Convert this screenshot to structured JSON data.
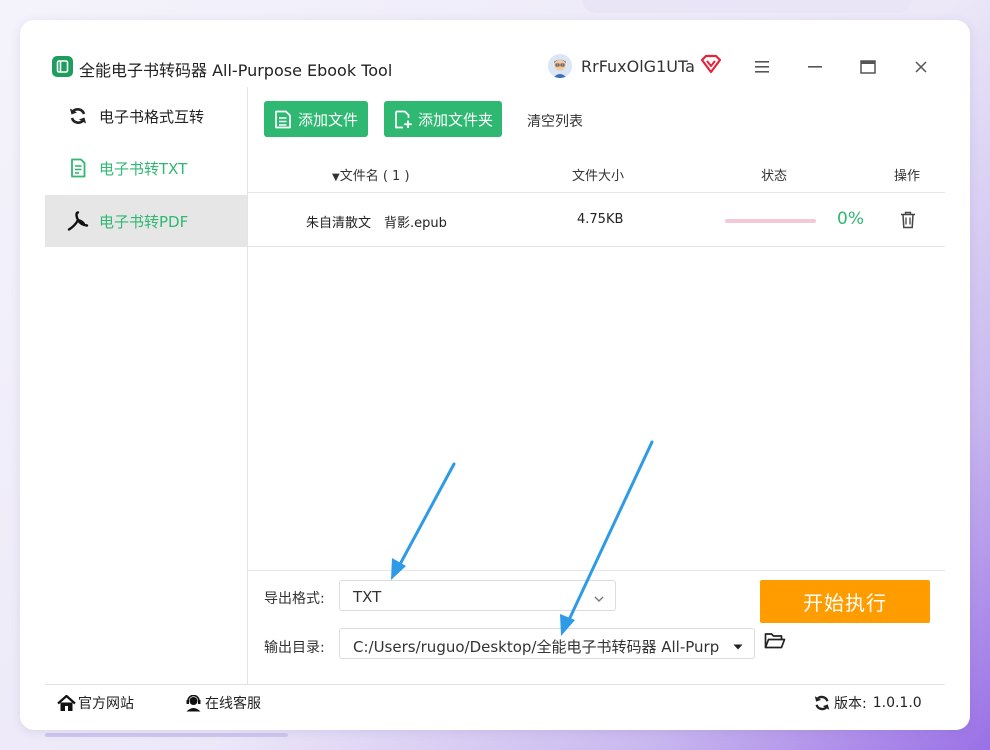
{
  "window": {
    "app_title": "全能电子书转码器 All-Purpose Ebook Tool",
    "username": "RrFuxOlG1UTa",
    "icons": [
      "app-logo-icon",
      "avatar",
      "vip-diamond-icon",
      "menu-icon",
      "minimize-icon",
      "maximize-icon",
      "close-icon"
    ]
  },
  "sidebar": {
    "items": [
      {
        "label": "电子书格式互转",
        "icon": "refresh-icon",
        "active": false
      },
      {
        "label": "电子书转TXT",
        "icon": "document-icon",
        "active": false
      },
      {
        "label": "电子书转PDF",
        "icon": "pdf-icon",
        "active": true
      }
    ]
  },
  "toolbar": {
    "add_file_label": "添加文件",
    "add_folder_label": "添加文件夹",
    "clear_list_label": "清空列表"
  },
  "table": {
    "columns": {
      "name": "文件名 ( 1 )",
      "size": "文件大小",
      "status": "状态",
      "action": "操作"
    },
    "rows": [
      {
        "name": "朱自清散文　背影.epub",
        "size": "4.75KB",
        "progress": 0,
        "percent": "0%"
      }
    ]
  },
  "settings": {
    "format_label": "导出格式:",
    "format_value": "TXT",
    "output_label": "输出目录:",
    "output_value": "C:/Users/ruguo/Desktop/全能电子书转码器 All-Purp",
    "start_label": "开始执行"
  },
  "footer": {
    "website_label": "官方网站",
    "service_label": "在线客服",
    "version_label": "版本:",
    "version_value": "1.0.1.0"
  },
  "colors": {
    "accent_green": "#2eb872",
    "start_orange": "#ff9c00",
    "progress_track": "#f3c9d6",
    "annotation_arrow": "#2f9be6"
  }
}
